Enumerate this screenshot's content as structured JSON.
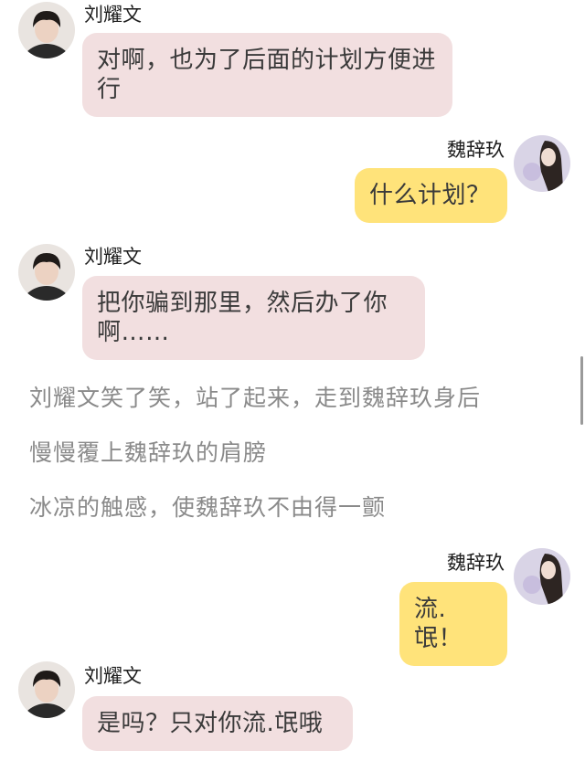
{
  "messages": [
    {
      "name": "刘耀文",
      "text": "对啊，也为了后面的计划方便进行"
    },
    {
      "name": "魏辞玖",
      "text": "什么计划？"
    },
    {
      "name": "刘耀文",
      "text": "把你骗到那里，然后办了你啊……"
    },
    {
      "name": "魏辞玖",
      "text": "流.氓！"
    },
    {
      "name": "刘耀文",
      "text": "是吗？只对你流.氓哦"
    }
  ],
  "narration": [
    "刘耀文笑了笑，站了起来，走到魏辞玖身后",
    "慢慢覆上魏辞玖的肩膀",
    "冰凉的触感，使魏辞玖不由得一颤"
  ],
  "colors": {
    "left_bubble": "#f2dfe0",
    "right_bubble": "#ffe37a",
    "narration_text": "#8a8a8a"
  },
  "icons": {
    "left_avatar": "boy-avatar-icon",
    "right_avatar": "girl-avatar-icon"
  }
}
